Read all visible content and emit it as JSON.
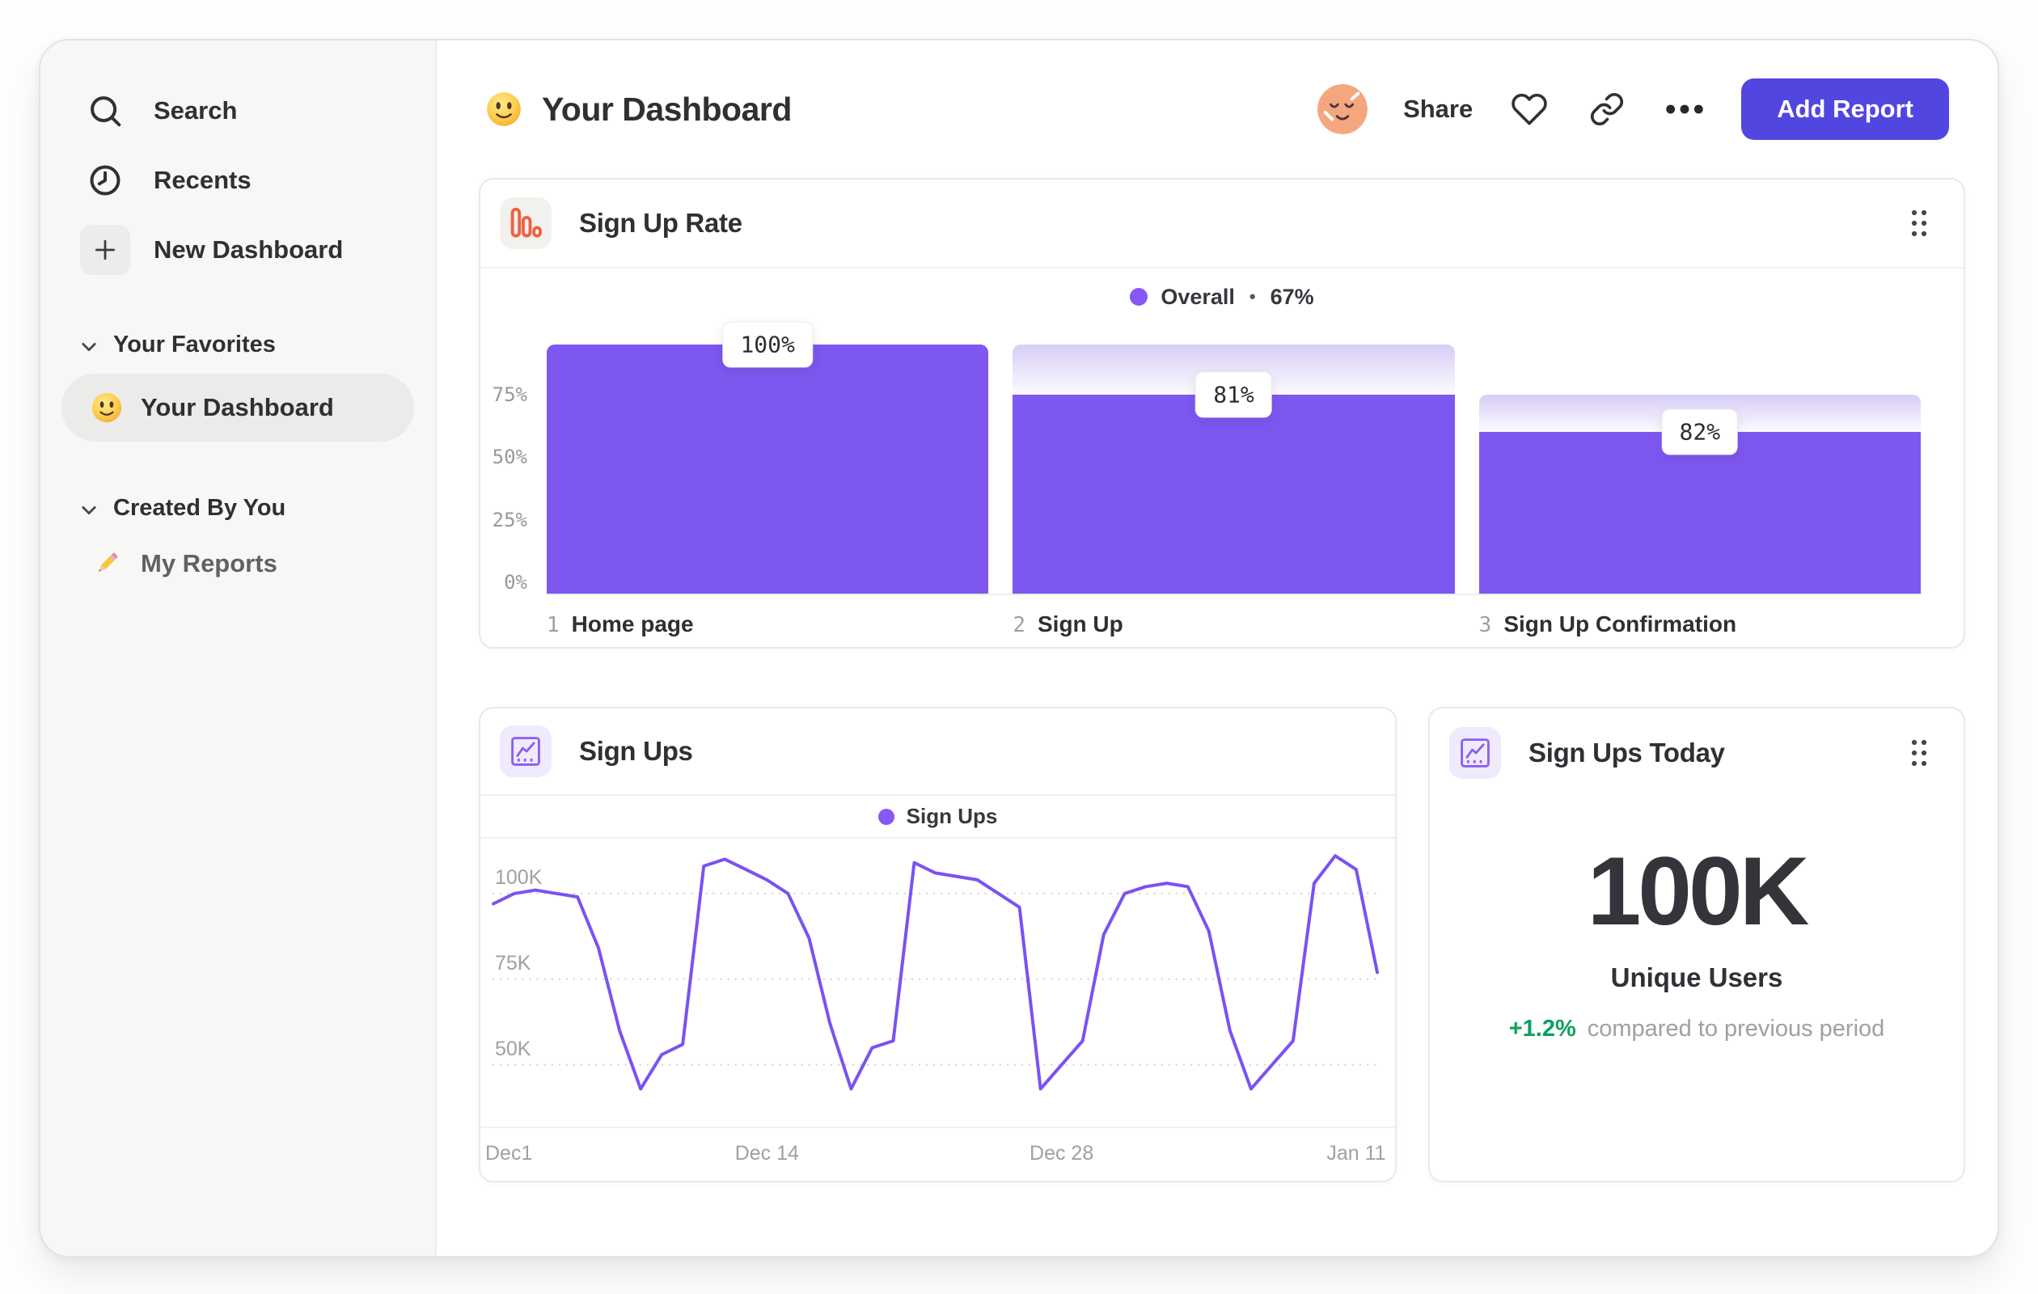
{
  "colors": {
    "accent_purple": "#7E57F0",
    "line_purple": "#7A52F3",
    "legend_dot_purple": "#8658F5",
    "button_purple": "#5246E0",
    "positive_green": "#0BA15E",
    "funnel_icon_orange": "#EE6244",
    "chart_icon_purple": "#8B5CF6",
    "sidebar_bg": "#F7F7F5",
    "selected_pill_bg": "#EBEBE9"
  },
  "icons": [
    "search-icon",
    "clock-icon",
    "plus-icon",
    "chevron-down-icon",
    "smiley-emoji-icon",
    "pencil-emoji-icon",
    "avatar-face-icon",
    "heart-icon",
    "link-icon",
    "ellipsis-icon",
    "funnel-chart-icon",
    "line-chart-icon",
    "drag-handle-icon"
  ],
  "sidebar": {
    "items": [
      {
        "label": "Search"
      },
      {
        "label": "Recents"
      },
      {
        "label": "New Dashboard"
      }
    ],
    "sections": [
      {
        "label": "Your Favorites",
        "items": [
          {
            "label": "Your Dashboard",
            "selected": true
          }
        ]
      },
      {
        "label": "Created By You",
        "items": [
          {
            "label": "My Reports",
            "selected": false
          }
        ]
      }
    ]
  },
  "header": {
    "title": "Your Dashboard",
    "share_label": "Share",
    "add_report_label": "Add Report"
  },
  "cards": {
    "sign_up_rate": {
      "title": "Sign Up Rate"
    },
    "sign_ups": {
      "title": "Sign Ups"
    },
    "sign_ups_today": {
      "title": "Sign Ups Today",
      "value": "100K",
      "value_label": "Unique Users",
      "delta": "+1.2%",
      "delta_caption": "compared to previous period"
    }
  },
  "chart_data": [
    {
      "id": "sign-up-rate-funnel",
      "type": "bar",
      "title": "Sign Up Rate",
      "legend": {
        "label": "Overall",
        "separator": "•",
        "value": "67%",
        "position": "top-center"
      },
      "ylim": [
        0,
        100
      ],
      "grid": false,
      "y_axis": [
        {
          "label": "75%",
          "value": 75
        },
        {
          "label": "50%",
          "value": 50
        },
        {
          "label": "25%",
          "value": 25
        },
        {
          "label": "0%",
          "value": 0
        }
      ],
      "steps": [
        {
          "index": "1",
          "label": "Home page",
          "value_label": "100%",
          "conversion_pct": 100,
          "overall_pct": 100
        },
        {
          "index": "2",
          "label": "Sign Up",
          "value_label": "81%",
          "conversion_pct": 81,
          "overall_pct": 80
        },
        {
          "index": "3",
          "label": "Sign Up Confirmation",
          "value_label": "82%",
          "conversion_pct": 82,
          "overall_pct": 65
        }
      ]
    },
    {
      "id": "sign-ups-line",
      "type": "line",
      "title": "Sign Ups",
      "legend": {
        "label": "Sign Ups",
        "position": "top-center"
      },
      "xlabel": "",
      "ylabel": "",
      "y_unit": "K",
      "ylim": [
        32,
        116
      ],
      "x_days": 42,
      "x_ticks": [
        {
          "label": "Dec1",
          "day": 0
        },
        {
          "label": "Dec 14",
          "day": 13
        },
        {
          "label": "Dec 28",
          "day": 27
        },
        {
          "label": "Jan 11",
          "day": 41
        }
      ],
      "y_ticks": [
        {
          "label": "100K",
          "value": 100
        },
        {
          "label": "75K",
          "value": 75
        },
        {
          "label": "50K",
          "value": 50
        }
      ],
      "series": [
        {
          "name": "Sign Ups",
          "values": [
            97,
            100,
            101,
            100,
            99,
            84,
            60,
            43,
            53,
            56,
            108,
            110,
            107,
            104,
            100,
            87,
            62,
            43,
            55,
            57,
            109,
            106,
            105,
            104,
            100,
            96,
            43,
            50,
            57,
            88,
            100,
            102,
            103,
            102,
            89,
            60,
            43,
            50,
            57,
            103,
            111,
            107,
            77
          ]
        }
      ]
    }
  ]
}
